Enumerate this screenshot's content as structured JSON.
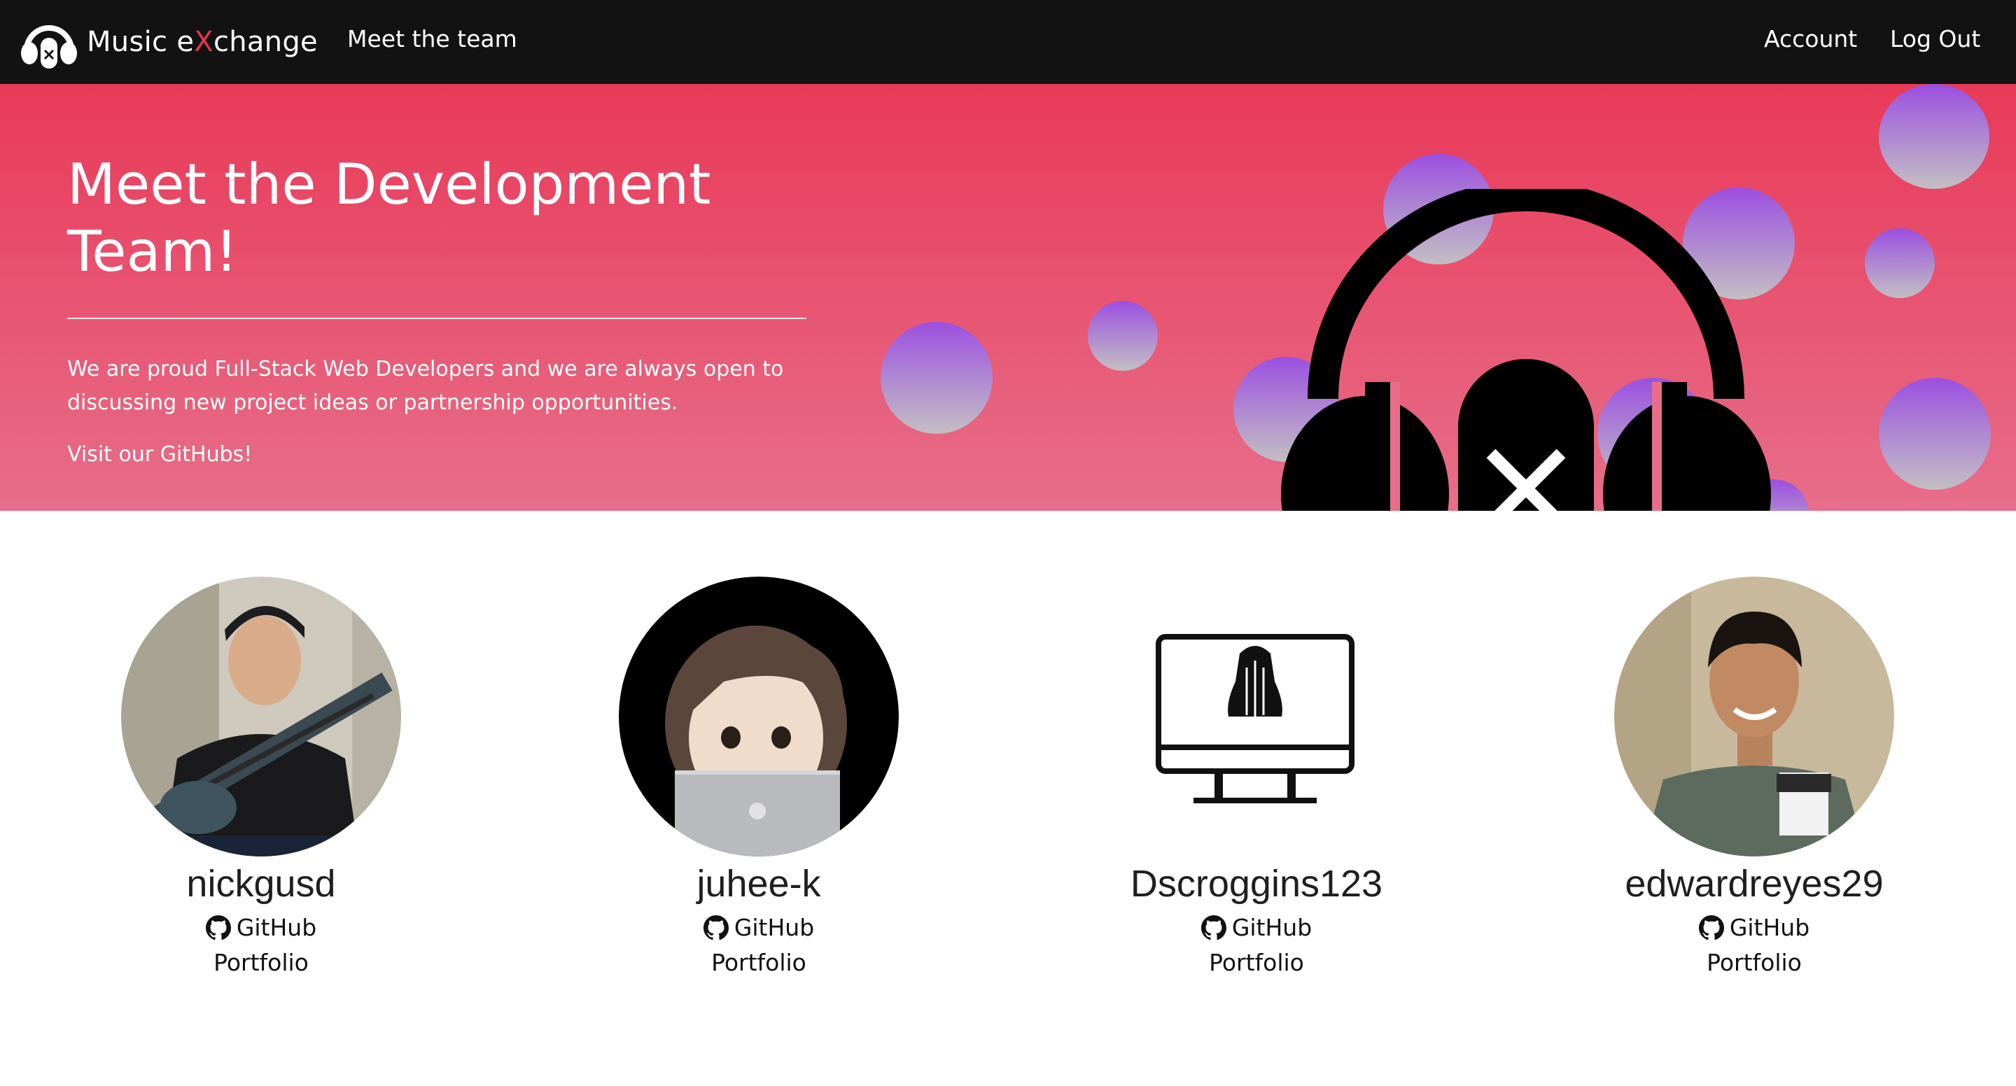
{
  "navbar": {
    "brand_prefix": "Music e",
    "brand_x": "X",
    "brand_suffix": "change",
    "links": {
      "team": "Meet the team",
      "account": "Account",
      "logout": "Log Out"
    }
  },
  "hero": {
    "title": "Meet the Development Team!",
    "description": "We are proud Full-Stack Web Developers and we are always open to discussing new project ideas or partnership opportunities.",
    "visit": "Visit our GitHubs!"
  },
  "team": [
    {
      "name": "nickgusd",
      "github": "GitHub",
      "portfolio": "Portfolio"
    },
    {
      "name": "juhee-k",
      "github": "GitHub",
      "portfolio": "Portfolio"
    },
    {
      "name": "Dscroggins123",
      "github": "GitHub",
      "portfolio": "Portfolio"
    },
    {
      "name": "edwardreyes29",
      "github": "GitHub",
      "portfolio": "Portfolio"
    }
  ],
  "colors": {
    "navbar": "#121212",
    "accent": "#e8344f",
    "hero_top": "#e83a58",
    "hero_bottom": "#e76e8a",
    "bubble_top": "#9b4fe0",
    "bubble_bottom": "#c3bfc3"
  },
  "icons": {
    "github": "github-icon",
    "brand": "headphones-x-logo"
  }
}
